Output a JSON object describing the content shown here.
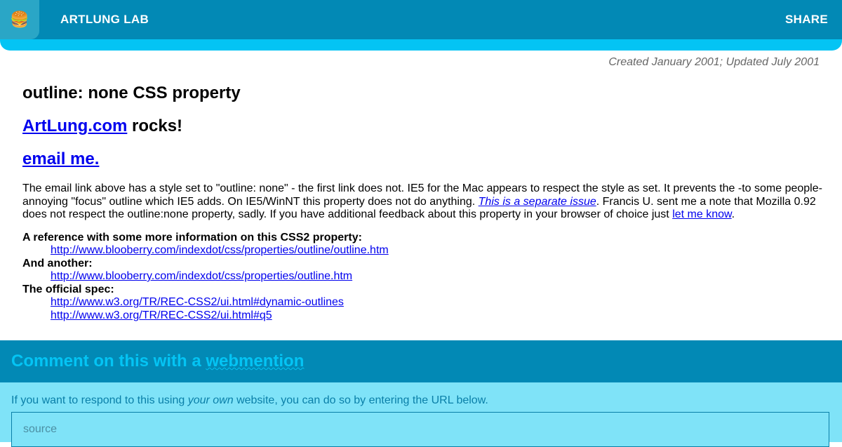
{
  "header": {
    "logo_emoji": "🍔",
    "site_title": "ARTLUNG LAB",
    "share_label": "SHARE",
    "colors": {
      "bar": "#0289b5",
      "stripe": "#04c4f4"
    }
  },
  "meta": {
    "dates": "Created January 2001; Updated July 2001"
  },
  "article": {
    "title": "outline: none CSS property",
    "line1_link": "ArtLung.com",
    "line1_rest": " rocks!",
    "line2_link": "email me.",
    "para_part1": "The email link above has a style set to \"outline: none\" - the first link does not. IE5 for the Mac appears to respect the style as set. It prevents the -to some people- annoying \"focus\" outline which IE5 adds. On IE5/WinNT this property does not do anything. ",
    "para_link1": "This is a separate issue",
    "para_part2": ". Francis U. sent me a note that Mozilla 0.92 does not respect the outline:none property, sadly. If you have additional feedback about this property in your browser of choice just ",
    "para_link2": "let me know",
    "para_part3": ".",
    "refs": [
      {
        "label": "A reference with some more information on this CSS2 property:",
        "links": [
          "http://www.blooberry.com/indexdot/css/properties/outline/outline.htm"
        ]
      },
      {
        "label": "And another:",
        "links": [
          "http://www.blooberry.com/indexdot/css/properties/outline.htm"
        ]
      },
      {
        "label": "The official spec:",
        "links": [
          "http://www.w3.org/TR/REC-CSS2/ui.html#dynamic-outlines",
          "http://www.w3.org/TR/REC-CSS2/ui.html#q5"
        ]
      }
    ]
  },
  "comments": {
    "title_prefix": "Comment on this with a ",
    "title_link": "webmention",
    "intro_part1": "If you want to respond to this using ",
    "intro_em": "your own",
    "intro_part2": " website, you can do so by entering the URL below.",
    "source_placeholder": "source"
  }
}
